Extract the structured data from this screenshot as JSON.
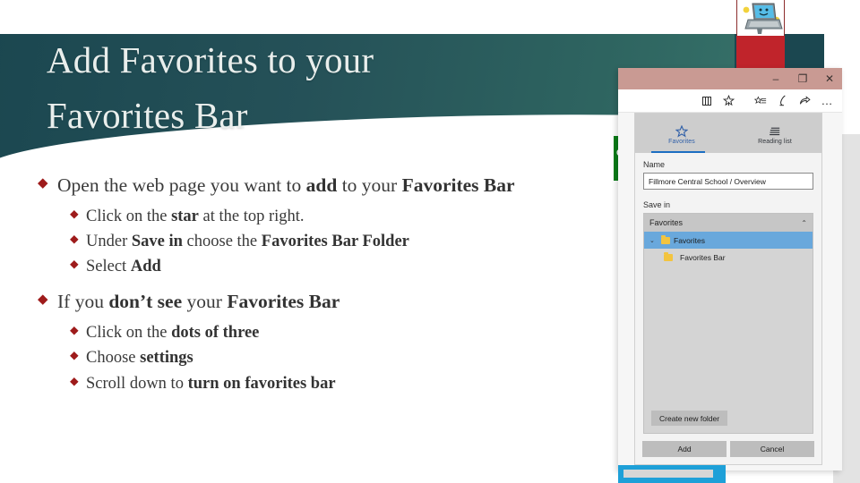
{
  "slide": {
    "title": "Add Favorites to your Favorites Bar",
    "title_line1": "Add Favorites to your",
    "title_line2": "Favorites Bar",
    "banner_color_start": "#1b4750",
    "banner_color_end": "#39766c",
    "bullet_color": "#9e1b1b"
  },
  "bullets": [
    {
      "level1_html": "Open the web page you want to <b>add</b> to your <b>Favorites Bar</b>",
      "children": [
        "Click on the <b>star</b> at the top right.",
        "Under <b>Save in</b> choose the <b>Favorites Bar Folder</b>",
        "Select <b>Add</b>"
      ]
    },
    {
      "level1_html": "If you <b>don’t see</b> your <b>Favorites Bar</b>",
      "children": [
        "Click on the <b>dots of three</b>",
        "Choose <b>settings</b>",
        "Scroll down to <b>turn on favorites bar</b>"
      ]
    }
  ],
  "edge": {
    "window_controls": {
      "minimize": "–",
      "restore": "❐",
      "close": "✕"
    },
    "toolbar_icons": [
      "book-icon",
      "add-favorite-star-icon",
      "hub-favorites-icon",
      "web-notes-pen-icon",
      "share-icon",
      "more-ellipsis-icon"
    ],
    "toolbar_more_label": "…",
    "panel": {
      "tabs": [
        {
          "label": "Favorites",
          "icon": "star-icon",
          "active": true
        },
        {
          "label": "Reading list",
          "icon": "reading-list-icon",
          "active": false
        }
      ],
      "name_label": "Name",
      "name_value": "Fillmore Central School / Overview",
      "savein_label": "Save in",
      "tree_header": "Favorites",
      "tree_header_chevron": "⌃",
      "tree_items": [
        {
          "label": "Favorites",
          "twisty": "⌄",
          "selected": true,
          "indent": 0
        },
        {
          "label": "Favorites Bar",
          "twisty": "",
          "selected": false,
          "indent": 1
        }
      ],
      "create_folder_button": "Create new folder",
      "add_button": "Add",
      "cancel_button": "Cancel"
    }
  },
  "decor": {
    "green_band_letter": "C",
    "scroll_arrow": "❯"
  }
}
